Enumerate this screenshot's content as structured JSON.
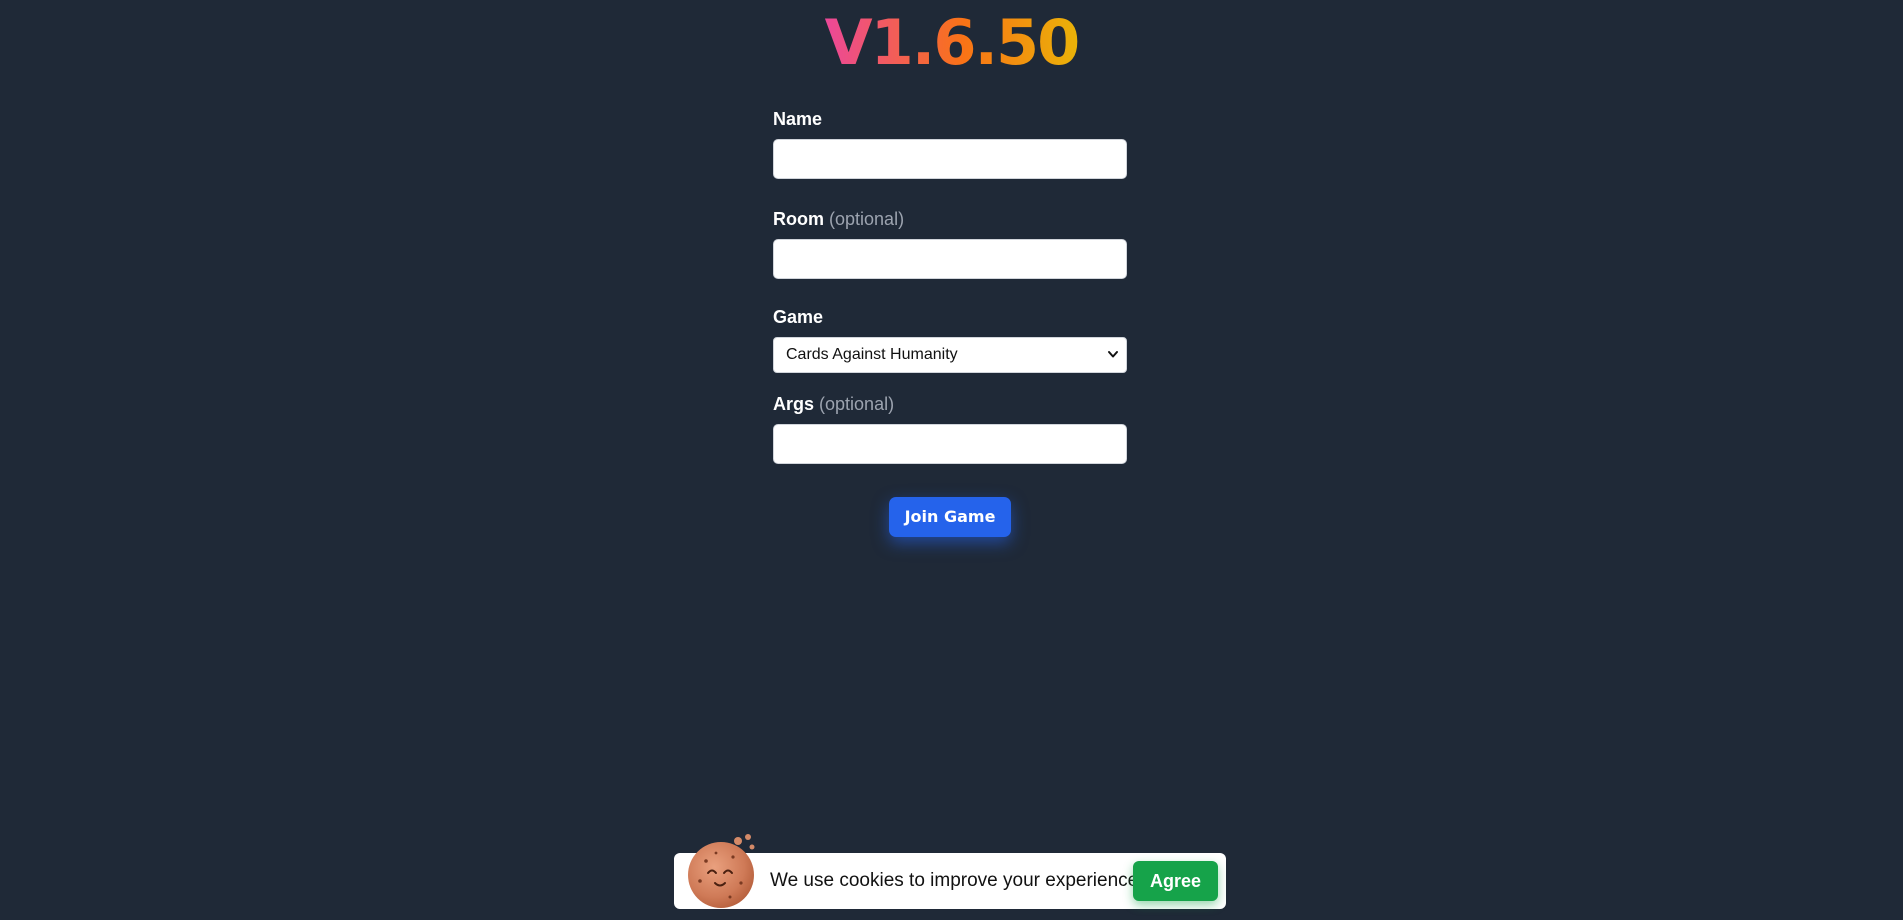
{
  "header": {
    "version": "V1.6.50"
  },
  "form": {
    "name": {
      "label": "Name",
      "value": ""
    },
    "room": {
      "label": "Room",
      "optional": "(optional)",
      "value": ""
    },
    "game": {
      "label": "Game",
      "selected": "Cards Against Humanity"
    },
    "args": {
      "label": "Args",
      "optional": "(optional)",
      "value": ""
    },
    "join_label": "Join Game"
  },
  "cookie": {
    "icon": "cookie-icon",
    "message": "We use cookies to improve your experience.",
    "agree_label": "Agree"
  },
  "colors": {
    "background": "#1f2937",
    "primary_button": "#2563eb",
    "agree_button": "#16a34a",
    "version_gradient": [
      "#ec4899",
      "#f97316",
      "#eab308"
    ],
    "optional_text": "#9ca3af"
  }
}
